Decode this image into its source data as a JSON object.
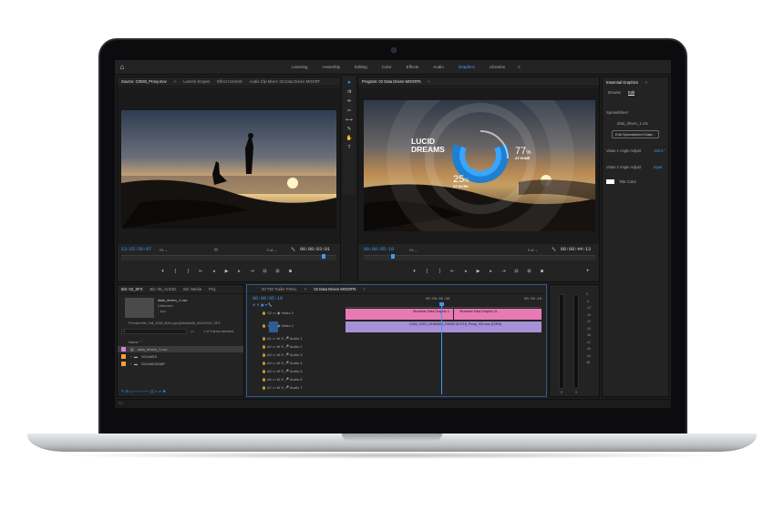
{
  "workspace": {
    "tabs": [
      "Learning",
      "Assembly",
      "Editing",
      "Color",
      "Effects",
      "Audio",
      "Graphics",
      "Libraries"
    ],
    "active_tab": "Graphics",
    "more": "»"
  },
  "source_panel": {
    "tabs": [
      "Source: C0030_Proxy.mov",
      "Lumetri Scopes",
      "Effect Controls",
      "Audio Clip Mixer: 02 Data Driven MOGRT"
    ],
    "timecode": "13:15:50:07",
    "fit": "Fit",
    "resolution": "Full",
    "duration": "00:00:03:01"
  },
  "program_panel": {
    "tab": "Program: 02 Data Driven MOGRTs",
    "timecode": "00:00:05:10",
    "fit": "Fit",
    "resolution": "Full",
    "duration": "00:00:44:13",
    "overlay": {
      "title_line1": "LUCID",
      "title_line2": "DREAMS",
      "stat1_value": "77",
      "stat1_unit": "%",
      "stat1_label": "AT HOME",
      "stat2_value": "25",
      "stat2_unit": "%",
      "stat2_label": "AT WORK"
    }
  },
  "essential_graphics": {
    "title": "Essential Graphics",
    "tabs": [
      "Browse",
      "Edit"
    ],
    "active_tab": "Edit",
    "section": "Spreadsheet",
    "file": "data_driven_1.csv",
    "edit_button": "Edit Spreadsheet Data...",
    "value1_label": "Value 1 Angle Adjust",
    "value1": "120.0 °",
    "value2_label": "Value 2 Angle Adjust",
    "value2": "Input",
    "title_color_label": "Title Color",
    "title_color": "#ffffff"
  },
  "project_panel": {
    "tabs": [
      "Bin: 02_SFX",
      "Bin: 06_AUDIO",
      "Bin: Media",
      "Proj"
    ],
    "clip_name": "data_driven_1.csv",
    "clip_meta1": "Unknown",
    "clip_meta2": ", 1pc",
    "path": "PremiereMe_Fall_2018_MAX.prproj\\Media\\06_AUDIO\\02_SFX",
    "count": "1 of 3 items selected",
    "column": "Name",
    "items": [
      {
        "name": "data_driven_1.csv",
        "color": "#d77fe0"
      },
      {
        "name": "SOUNDS",
        "color": "#f0a23c"
      },
      {
        "name": "SOUNDSWAP",
        "color": "#f0a23c"
      }
    ]
  },
  "timeline": {
    "tabs": [
      "00 T30 Trailer FINAL",
      "02 Data Driven MOGRTs"
    ],
    "timecode": "00:00:05:10",
    "ruler": [
      "00:00:05:00",
      "00:00:10"
    ],
    "video_tracks": [
      "Video 2",
      "Video 1"
    ],
    "audio_tracks": [
      "Audio 1",
      "Audio 2",
      "Audio 3",
      "Audio 4",
      "Audio 5",
      "Audio 6",
      "Audio 7"
    ],
    "clips_v2": [
      "Streamer Data Graphic.1",
      "Streamer Data Graphic.11"
    ],
    "clip_v1": "C004_C001_20160524_R0000 012718_Proxy_HD.mov [125%]"
  },
  "meters": {
    "scale": [
      "0",
      "-6",
      "-12",
      "-18",
      "-24",
      "-30",
      "-36",
      "-42",
      "-48",
      "-54",
      "dB"
    ],
    "channels": [
      "S",
      "S"
    ]
  }
}
